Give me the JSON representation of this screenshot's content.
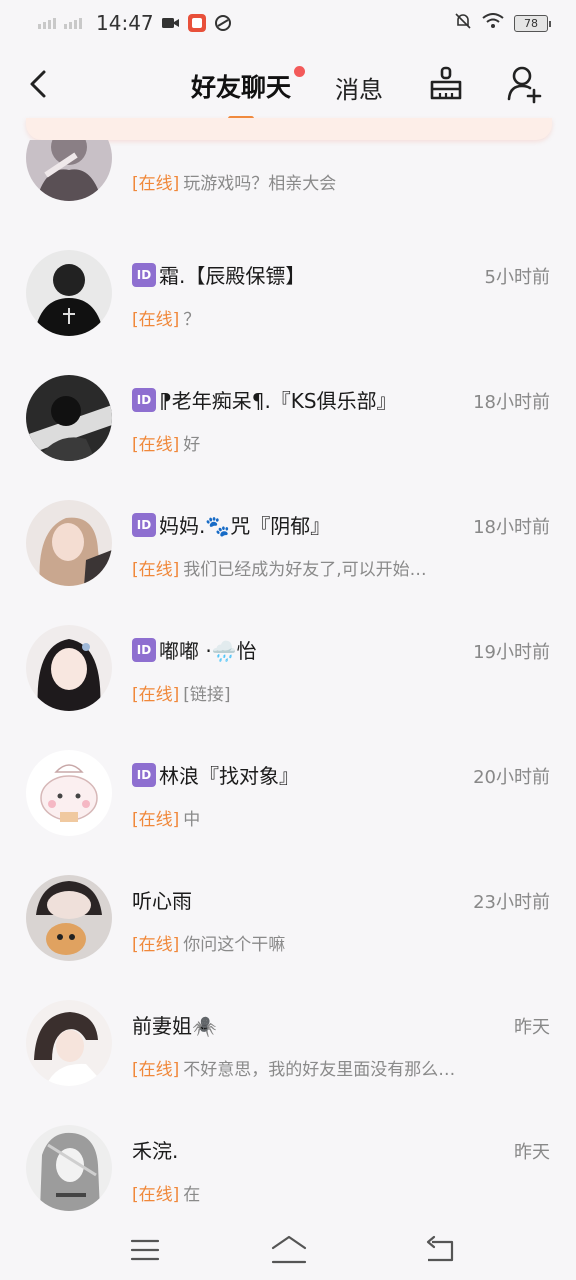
{
  "status_bar": {
    "time": "14:47",
    "battery": "78"
  },
  "header": {
    "tab_chat": "好友聊天",
    "tab_messages": "消息",
    "badge_color": "#f35a5a",
    "accent": "#f08a3c"
  },
  "chats": [
    {
      "name": "",
      "time": "",
      "status": "[在线]",
      "message": "玩游戏吗？相亲大会",
      "has_id": false
    },
    {
      "name": "霜.【辰殿保镖】",
      "time": "5小时前",
      "status": "[在线]",
      "message": "？",
      "has_id": true
    },
    {
      "name": "⁋老年痴呆¶.『KS俱乐部』",
      "time": "18小时前",
      "status": "[在线]",
      "message": "好",
      "has_id": true
    },
    {
      "name": "妈妈.🐾咒『阴郁』",
      "time": "18小时前",
      "status": "[在线]",
      "message": "我们已经成为好友了,可以开始…",
      "has_id": true
    },
    {
      "name": "嘟嘟 ·🌧️怡",
      "time": "19小时前",
      "status": "[在线]",
      "message": "[链接]",
      "has_id": true
    },
    {
      "name": "林浪『找对象』",
      "time": "20小时前",
      "status": "[在线]",
      "message": "中",
      "has_id": true
    },
    {
      "name": "听心雨",
      "time": "23小时前",
      "status": "[在线]",
      "message": "你问这个干嘛",
      "has_id": false
    },
    {
      "name": "前妻姐🕷️",
      "time": "昨天",
      "status": "[在线]",
      "message": "不好意思，我的好友里面没有那么…",
      "has_id": false
    },
    {
      "name": "禾浣.",
      "time": "昨天",
      "status": "[在线]",
      "message": "在",
      "has_id": false
    }
  ],
  "icons": {
    "back": "chevron-left-icon",
    "clean": "broom-icon",
    "add_friend": "add-user-icon",
    "nav_menu": "menu-icon",
    "nav_home": "home-icon",
    "nav_back": "return-icon"
  }
}
